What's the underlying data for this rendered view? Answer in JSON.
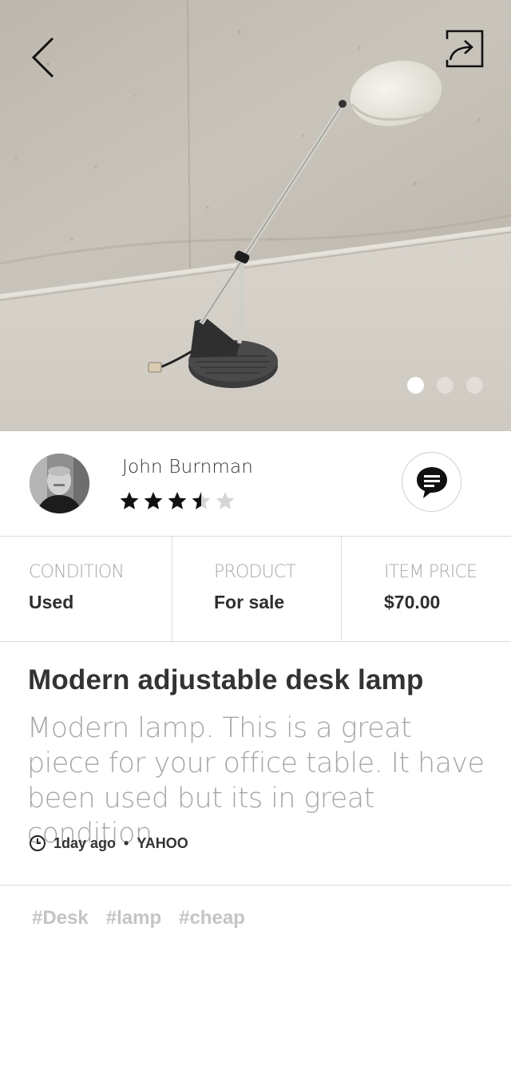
{
  "listing": {
    "image_count": 3,
    "active_image": 1
  },
  "seller": {
    "name": "John Burnman",
    "rating": 3.5,
    "max_rating": 5
  },
  "info": {
    "condition_label": "CONDITION",
    "condition_value": "Used",
    "product_label": "PRODUCT",
    "product_value": "For sale",
    "price_label": "ITEM PRICE",
    "price_value": "$70.00"
  },
  "description": {
    "title": "Modern adjustable desk lamp",
    "text": "Modern lamp. This is a great piece for your office table. It have been used but its in great condition",
    "posted": "1day ago",
    "source": "YAHOO"
  },
  "tags": [
    "#Desk",
    "#lamp",
    "#cheap"
  ],
  "colors": {
    "text_dark": "#2e2e2e",
    "text_muted": "#a7a7a7",
    "tag": "#c4c4c4",
    "divider": "#dcdcdc"
  },
  "icons": {
    "back": "chevron-left-icon",
    "share": "share-icon",
    "chat": "chat-bubble-icon",
    "clock": "clock-icon"
  }
}
